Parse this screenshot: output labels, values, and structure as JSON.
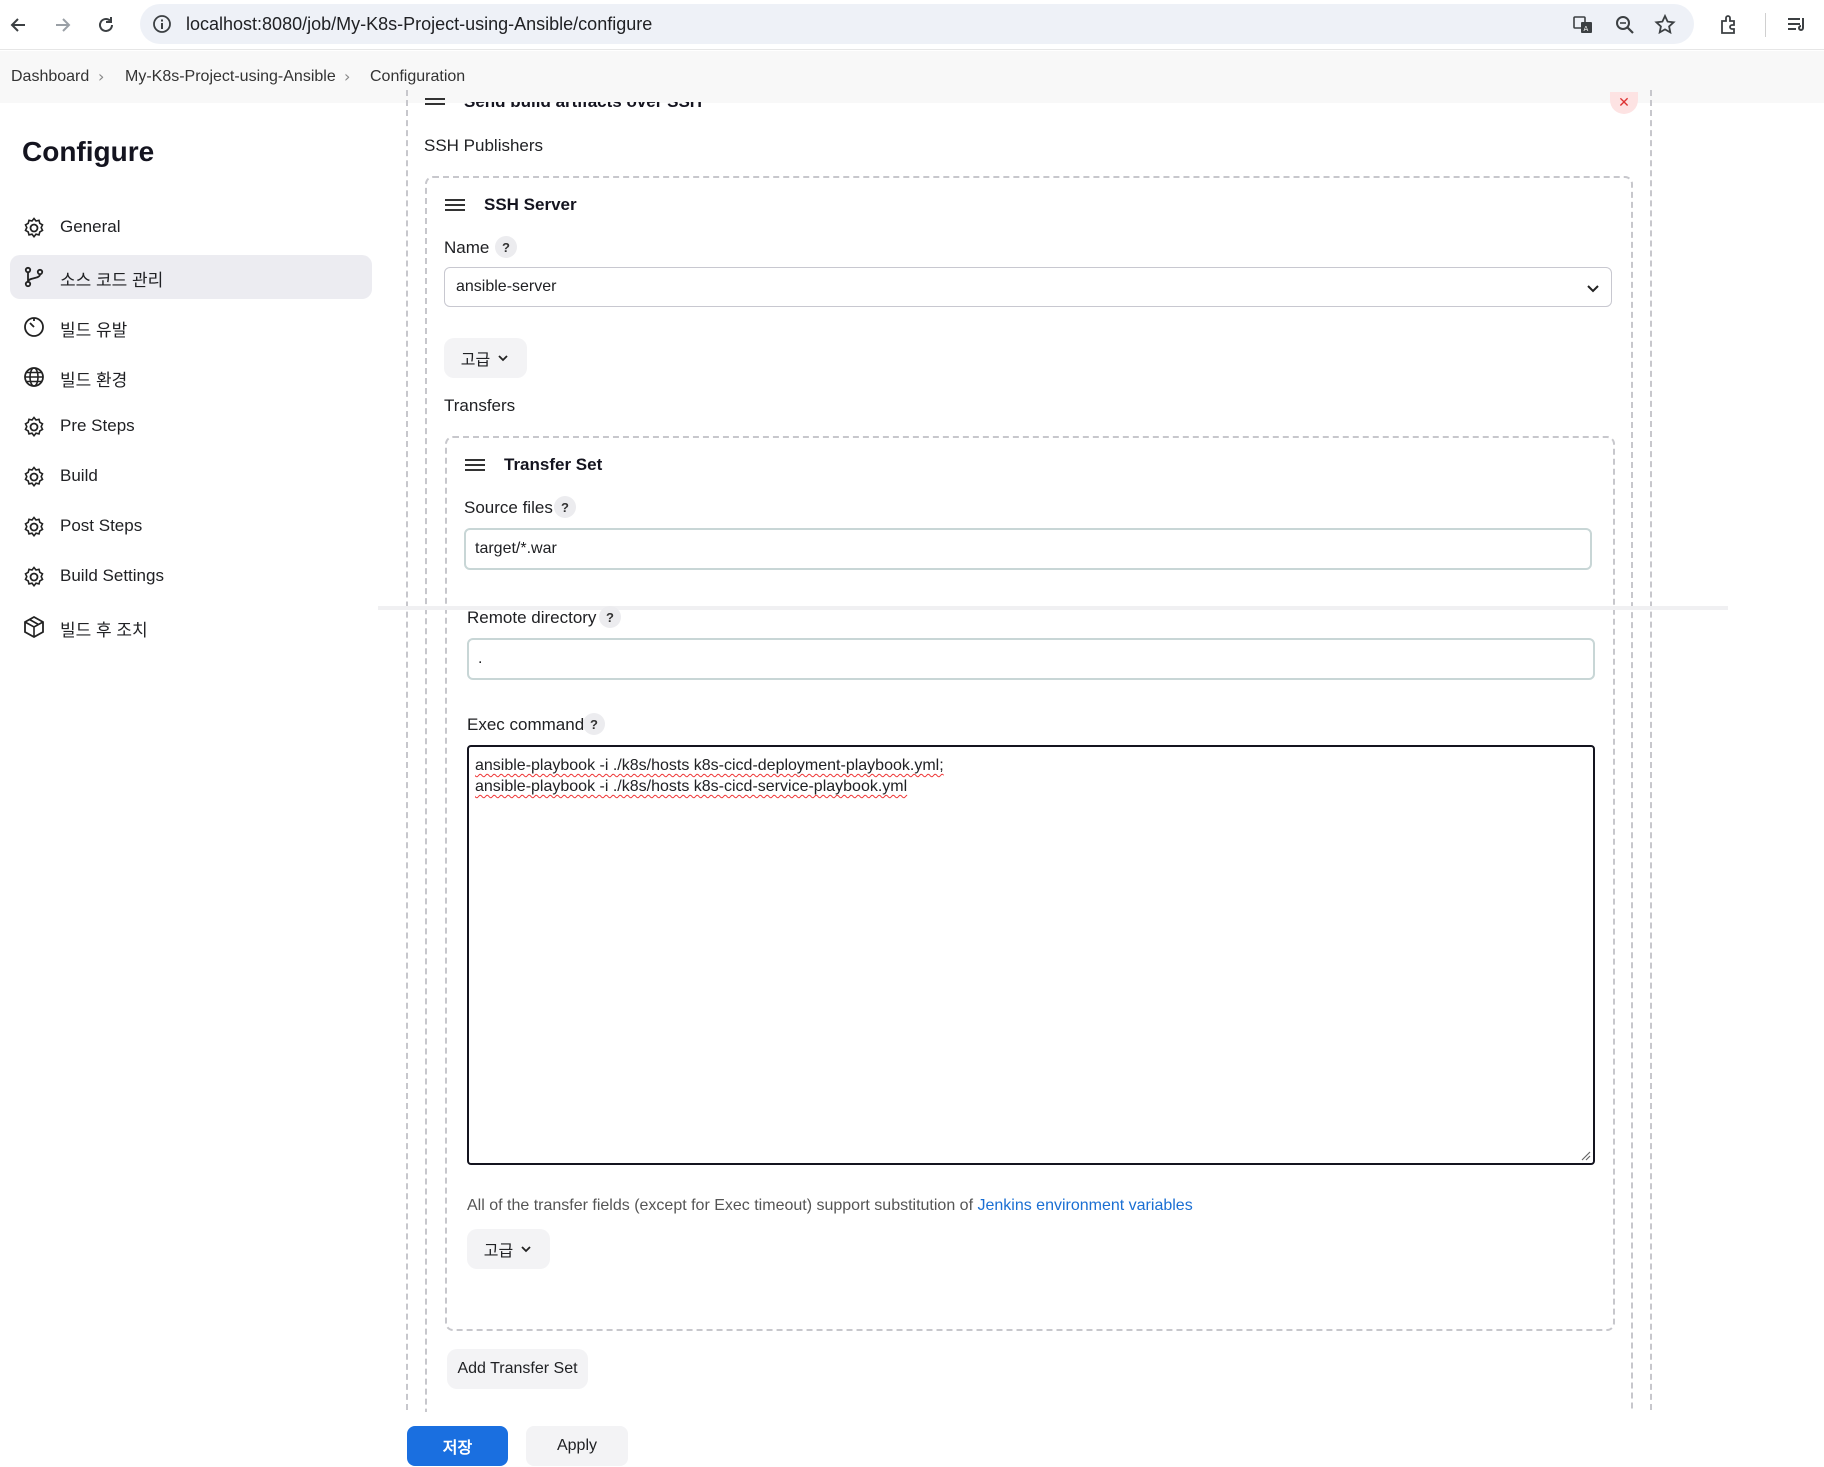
{
  "browser": {
    "url": "localhost:8080/job/My-K8s-Project-using-Ansible/configure"
  },
  "breadcrumb": {
    "items": [
      "Dashboard",
      "My-K8s-Project-using-Ansible",
      "Configuration"
    ]
  },
  "sidebar": {
    "title": "Configure",
    "items": [
      {
        "label": "General",
        "icon": "gear-icon"
      },
      {
        "label": "소스 코드 관리",
        "icon": "branch-icon"
      },
      {
        "label": "빌드 유발",
        "icon": "timer-icon"
      },
      {
        "label": "빌드 환경",
        "icon": "globe-icon"
      },
      {
        "label": "Pre Steps",
        "icon": "gear-icon"
      },
      {
        "label": "Build",
        "icon": "gear-icon"
      },
      {
        "label": "Post Steps",
        "icon": "gear-icon"
      },
      {
        "label": "Build Settings",
        "icon": "gear-icon"
      },
      {
        "label": "빌드 후 조치",
        "icon": "package-icon"
      }
    ],
    "active_index": 1
  },
  "main": {
    "section_title": "Send build artifacts over SSH",
    "ssh_publishers_label": "SSH Publishers",
    "ssh_server": {
      "title": "SSH Server",
      "name_label": "Name",
      "name_value": "ansible-server",
      "advanced_label": "고급"
    },
    "transfers_label": "Transfers",
    "transfer_set": {
      "title": "Transfer Set",
      "source_files_label": "Source files",
      "source_files_value": "target/*.war",
      "remote_directory_label": "Remote directory",
      "remote_directory_value": ".",
      "exec_command_label": "Exec command",
      "exec_command_lines": [
        "ansible-playbook -i ./k8s/hosts k8s-cicd-deployment-playbook.yml;",
        "ansible-playbook -i ./k8s/hosts k8s-cicd-service-playbook.yml"
      ],
      "note_text": "All of the transfer fields (except for Exec timeout) support substitution of ",
      "note_link": "Jenkins environment variables",
      "advanced_label": "고급"
    },
    "add_transfer_set_label": "Add Transfer Set",
    "help_glyph": "?"
  },
  "footer": {
    "save_label": "저장",
    "apply_label": "Apply"
  },
  "colors": {
    "primary": "#1a6fe0",
    "link": "#1a6fd3"
  }
}
